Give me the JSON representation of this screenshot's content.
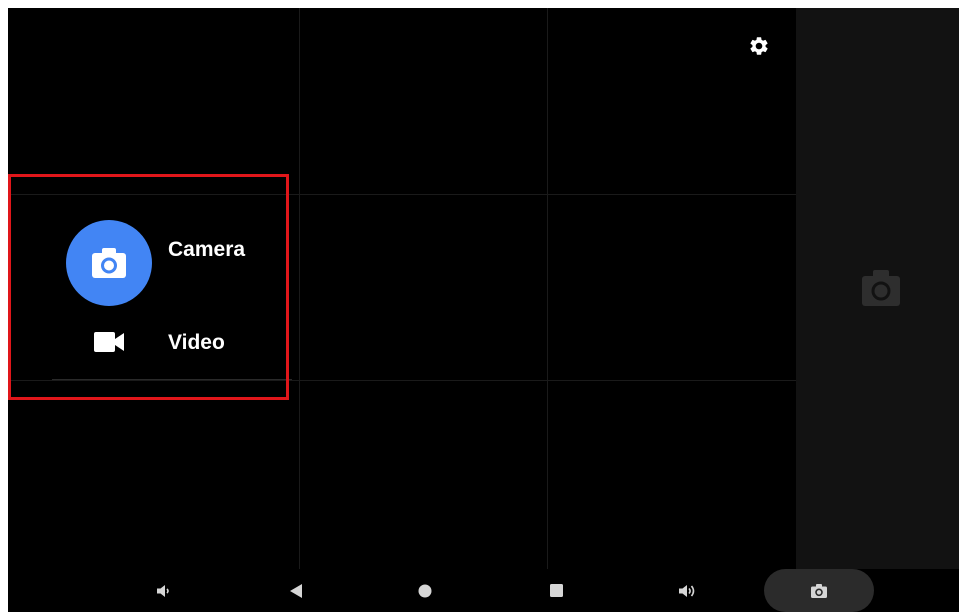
{
  "settings": {
    "icon": "gear-icon"
  },
  "mode_menu": {
    "items": [
      {
        "label": "Camera",
        "icon": "camera-icon",
        "selected": true
      },
      {
        "label": "Video",
        "icon": "videocam-icon",
        "selected": false
      }
    ]
  },
  "side_panel": {
    "icon": "camera-icon"
  },
  "navbar": {
    "items": [
      {
        "icon": "volume-down-icon"
      },
      {
        "icon": "back-icon"
      },
      {
        "icon": "home-icon"
      },
      {
        "icon": "recents-icon"
      },
      {
        "icon": "volume-up-icon"
      },
      {
        "icon": "screenshot-icon"
      }
    ]
  },
  "colors": {
    "accent": "#4285f4",
    "highlight": "#e0161a",
    "background": "#000000",
    "side_panel": "#121212"
  }
}
